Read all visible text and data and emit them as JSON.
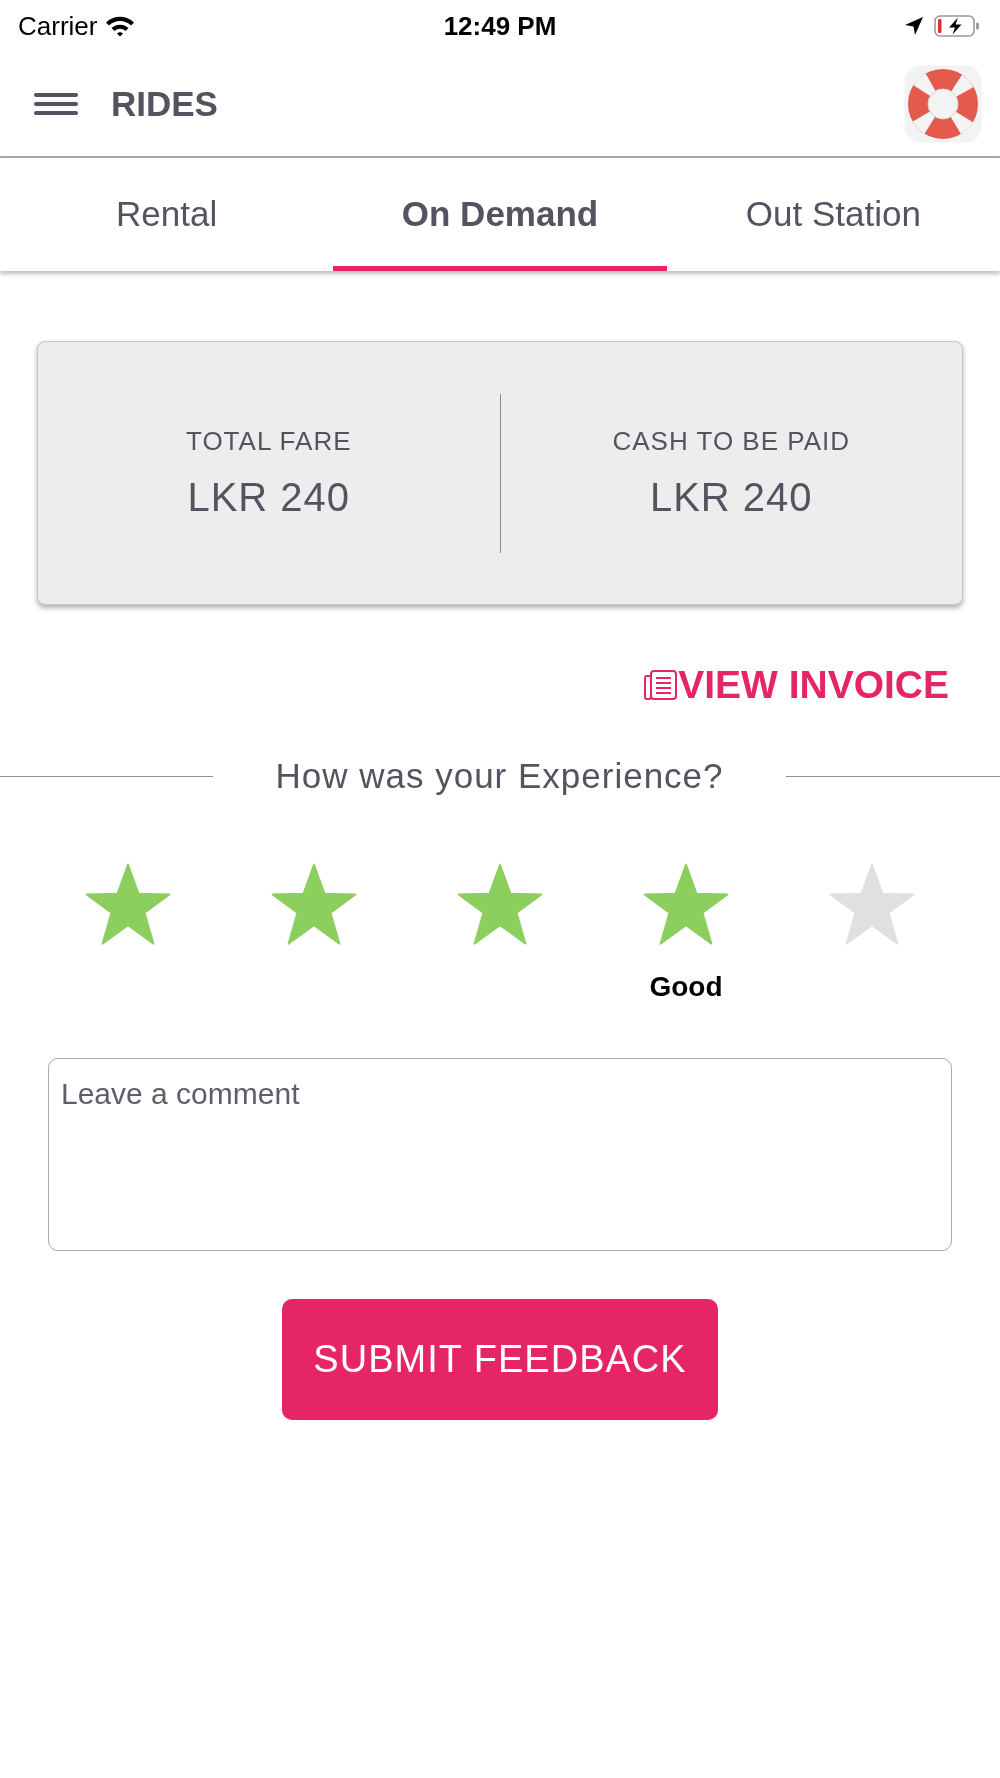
{
  "status_bar": {
    "carrier": "Carrier",
    "time": "12:49 PM"
  },
  "header": {
    "title": "RIDES"
  },
  "tabs": [
    {
      "label": "Rental",
      "selected": false
    },
    {
      "label": "On Demand",
      "selected": true
    },
    {
      "label": "Out Station",
      "selected": false
    }
  ],
  "fare_summary": [
    {
      "label": "TOTAL FARE",
      "amount": "LKR 240"
    },
    {
      "label": "CASH TO BE PAID",
      "amount": "LKR 240"
    }
  ],
  "invoice_link": "VIEW INVOICE",
  "feedback": {
    "question": "How was your Experience?",
    "stars": 4,
    "rating_label": "Good",
    "comment": {
      "placeholder": "Leave a comment"
    },
    "submit": "SUBMIT FEEDBACK"
  }
}
